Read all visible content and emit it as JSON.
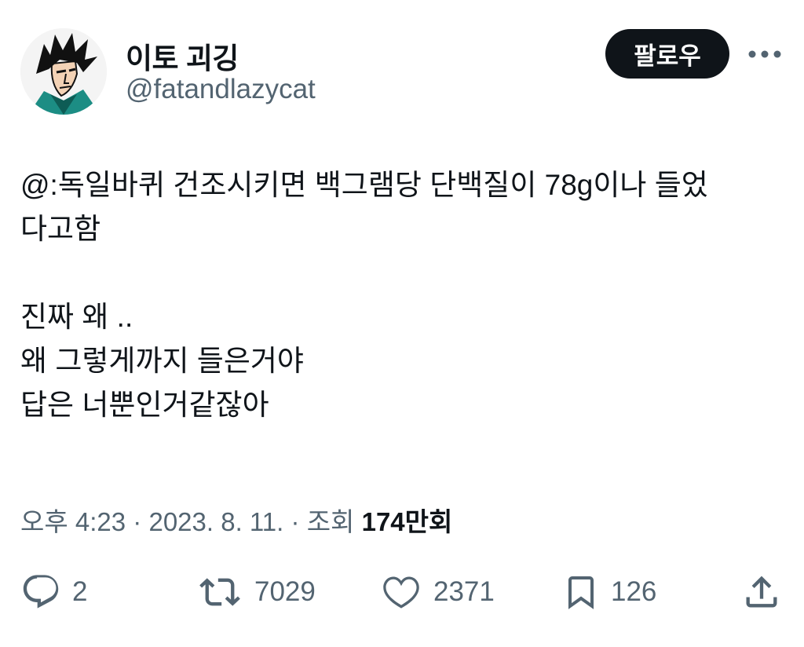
{
  "user": {
    "display_name": "이토 괴깅",
    "handle": "@fatandlazycat"
  },
  "follow_label": "팔로우",
  "tweet": {
    "lines": [
      "@:독일바퀴 건조시키면 백그램당 단백질이 78g이나 들었",
      "다고함",
      "진짜 왜 ..",
      "왜 그렇게까지 들은거야",
      "답은 너뿐인거같잖아"
    ]
  },
  "meta": {
    "time": "오후 4:23",
    "separator": "·",
    "date": "2023. 8. 11.",
    "views_prefix": "조회",
    "views_number": "174",
    "views_suffix": "만회"
  },
  "actions": {
    "replies": "2",
    "retweets": "7029",
    "likes": "2371",
    "bookmarks": "126"
  },
  "icons": [
    "more-icon",
    "reply-icon",
    "retweet-icon",
    "like-icon",
    "bookmark-icon",
    "share-icon"
  ],
  "colors": {
    "text_primary": "#0f1419",
    "text_secondary": "#536471",
    "follow_bg": "#0f1419"
  }
}
